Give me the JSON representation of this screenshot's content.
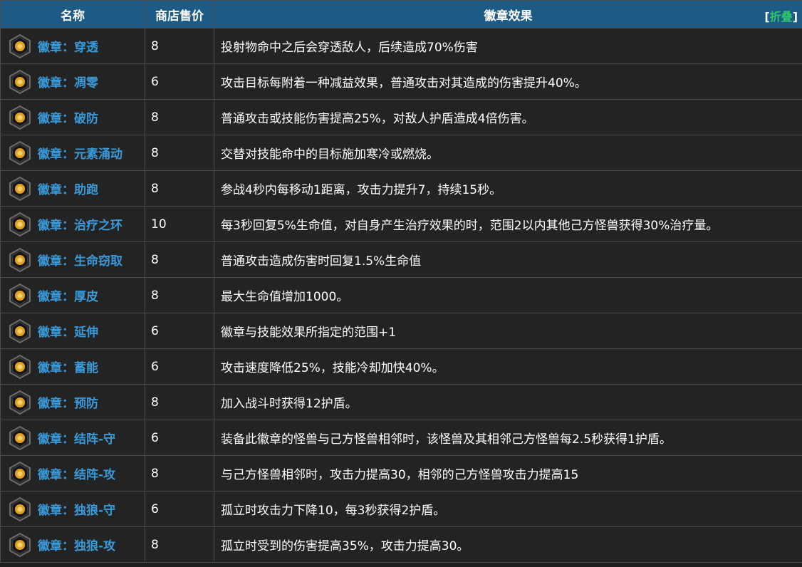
{
  "header": {
    "col_name": "名称",
    "col_price": "商店售价",
    "col_effect": "徽章效果",
    "fold_open": "[",
    "fold_label": "折叠",
    "fold_close": "]"
  },
  "rows": [
    {
      "name": "徽章：穿透",
      "price": "8",
      "effect": "投射物命中之后会穿透敌人，后续造成70%伤害",
      "icon": "arrow-pierce-icon"
    },
    {
      "name": "徽章：凋零",
      "price": "6",
      "effect": "攻击目标每附着一种减益效果，普通攻击对其造成的伤害提升40%。",
      "icon": "wither-icon"
    },
    {
      "name": "徽章：破防",
      "price": "8",
      "effect": "普通攻击或技能伤害提高25%，对敌人护盾造成4倍伤害。",
      "icon": "shield-break-icon"
    },
    {
      "name": "徽章：元素涌动",
      "price": "8",
      "effect": "交替对技能命中的目标施加寒冷或燃烧。",
      "icon": "element-surge-icon"
    },
    {
      "name": "徽章：助跑",
      "price": "8",
      "effect": "参战4秒内每移动1距离，攻击力提升7，持续15秒。",
      "icon": "run-up-icon"
    },
    {
      "name": "徽章：治疗之环",
      "price": "10",
      "effect": "每3秒回复5%生命值，对自身产生治疗效果的时，范围2以内其他己方怪兽获得30%治疗量。",
      "icon": "healing-ring-icon"
    },
    {
      "name": "徽章：生命窃取",
      "price": "8",
      "effect": "普通攻击造成伤害时回复1.5%生命值",
      "icon": "life-steal-icon"
    },
    {
      "name": "徽章：厚皮",
      "price": "8",
      "effect": "最大生命值增加1000。",
      "icon": "thick-skin-icon"
    },
    {
      "name": "徽章：延伸",
      "price": "6",
      "effect": "徽章与技能效果所指定的范围+1",
      "icon": "extend-icon"
    },
    {
      "name": "徽章：蓄能",
      "price": "6",
      "effect": "攻击速度降低25%，技能冷却加快40%。",
      "icon": "charge-icon"
    },
    {
      "name": "徽章：预防",
      "price": "8",
      "effect": "加入战斗时获得12护盾。",
      "icon": "prevention-icon"
    },
    {
      "name": "徽章：结阵-守",
      "price": "6",
      "effect": "装备此徽章的怪兽与己方怪兽相邻时，该怪兽及其相邻己方怪兽每2.5秒获得1护盾。",
      "icon": "formation-defense-icon"
    },
    {
      "name": "徽章：结阵-攻",
      "price": "8",
      "effect": "与己方怪兽相邻时，攻击力提高30，相邻的己方怪兽攻击力提高15",
      "icon": "formation-attack-icon"
    },
    {
      "name": "徽章：独狼-守",
      "price": "6",
      "effect": "孤立时攻击力下降10，每3秒获得2护盾。",
      "icon": "lone-wolf-defense-icon"
    },
    {
      "name": "徽章：独狼-攻",
      "price": "8",
      "effect": "孤立时受到的伤害提高35%，攻击力提高30。",
      "icon": "lone-wolf-attack-icon"
    }
  ],
  "colors": {
    "header_bg": "#1d5b86",
    "link": "#3a9ad9",
    "fold_link": "#2ec46f",
    "row_bg": "#232323",
    "icon_gold": "#e0a020"
  }
}
